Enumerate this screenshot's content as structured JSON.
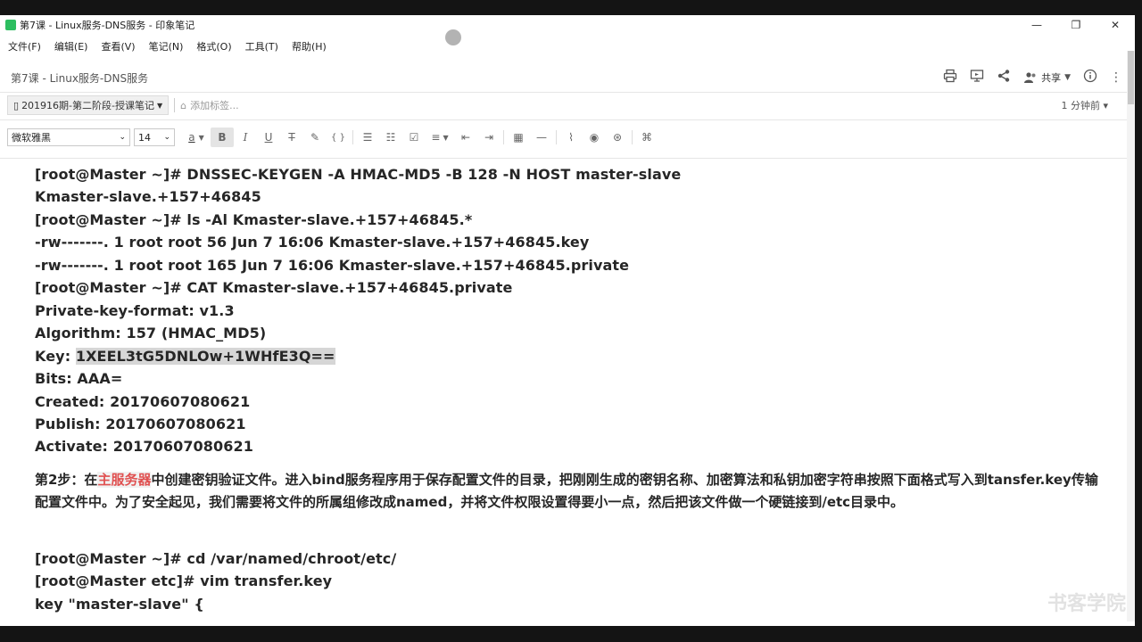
{
  "window": {
    "title": "第7课 - Linux服务-DNS服务 - 印象笔记",
    "minimize": "—",
    "maximize": "❐",
    "close": "✕"
  },
  "menu": [
    "文件(F)",
    "编辑(E)",
    "查看(V)",
    "笔记(N)",
    "格式(O)",
    "工具(T)",
    "帮助(H)"
  ],
  "note": {
    "title": "第7课 - Linux服务-DNS服务",
    "share_label": "共享",
    "notebook": "201916期-第二阶段-授课笔记",
    "add_tag_placeholder": "添加标签...",
    "modified": "1 分钟前"
  },
  "toolbar": {
    "font": "微软雅黑",
    "size": "14",
    "font_color_glyph": "a",
    "bold": "B",
    "italic": "I",
    "underline": "U",
    "strike": "T",
    "code": "{ }"
  },
  "content": {
    "lines": [
      "[root@Master ~]# DNSSEC-KEYGEN -A HMAC-MD5 -B 128 -N HOST master-slave",
      "Kmaster-slave.+157+46845",
      "[root@Master ~]# ls -Al Kmaster-slave.+157+46845.*",
      "-rw-------. 1 root root 56 Jun 7 16:06 Kmaster-slave.+157+46845.key",
      "-rw-------. 1 root root 165 Jun 7 16:06 Kmaster-slave.+157+46845.private",
      "[root@Master ~]# CAT Kmaster-slave.+157+46845.private",
      "Private-key-format: v1.3",
      "Algorithm: 157 (HMAC_MD5)"
    ],
    "key_label": "Key: ",
    "key_value": "1XEEL3tG5DNLOw+1WHfE3Q==",
    "lines2": [
      "Bits: AAA=",
      "Created: 20170607080621",
      "Publish: 20170607080621",
      "Activate: 20170607080621"
    ],
    "step_prefix": "第2步：在",
    "step_highlight": "主服务器",
    "step_rest": "中创建密钥验证文件。进入bind服务程序用于保存配置文件的目录，把刚刚生成的密钥名称、加密算法和私钥加密字符串按照下面格式写入到tansfer.key传输配置文件中。为了安全起见，我们需要将文件的所属组修改成named，并将文件权限设置得要小一点，然后把该文件做一个硬链接到/etc目录中。",
    "lines3": [
      "[root@Master ~]# cd /var/named/chroot/etc/",
      "[root@Master etc]# vim transfer.key",
      "key \"master-slave\" {"
    ]
  },
  "watermark": "书客学院"
}
